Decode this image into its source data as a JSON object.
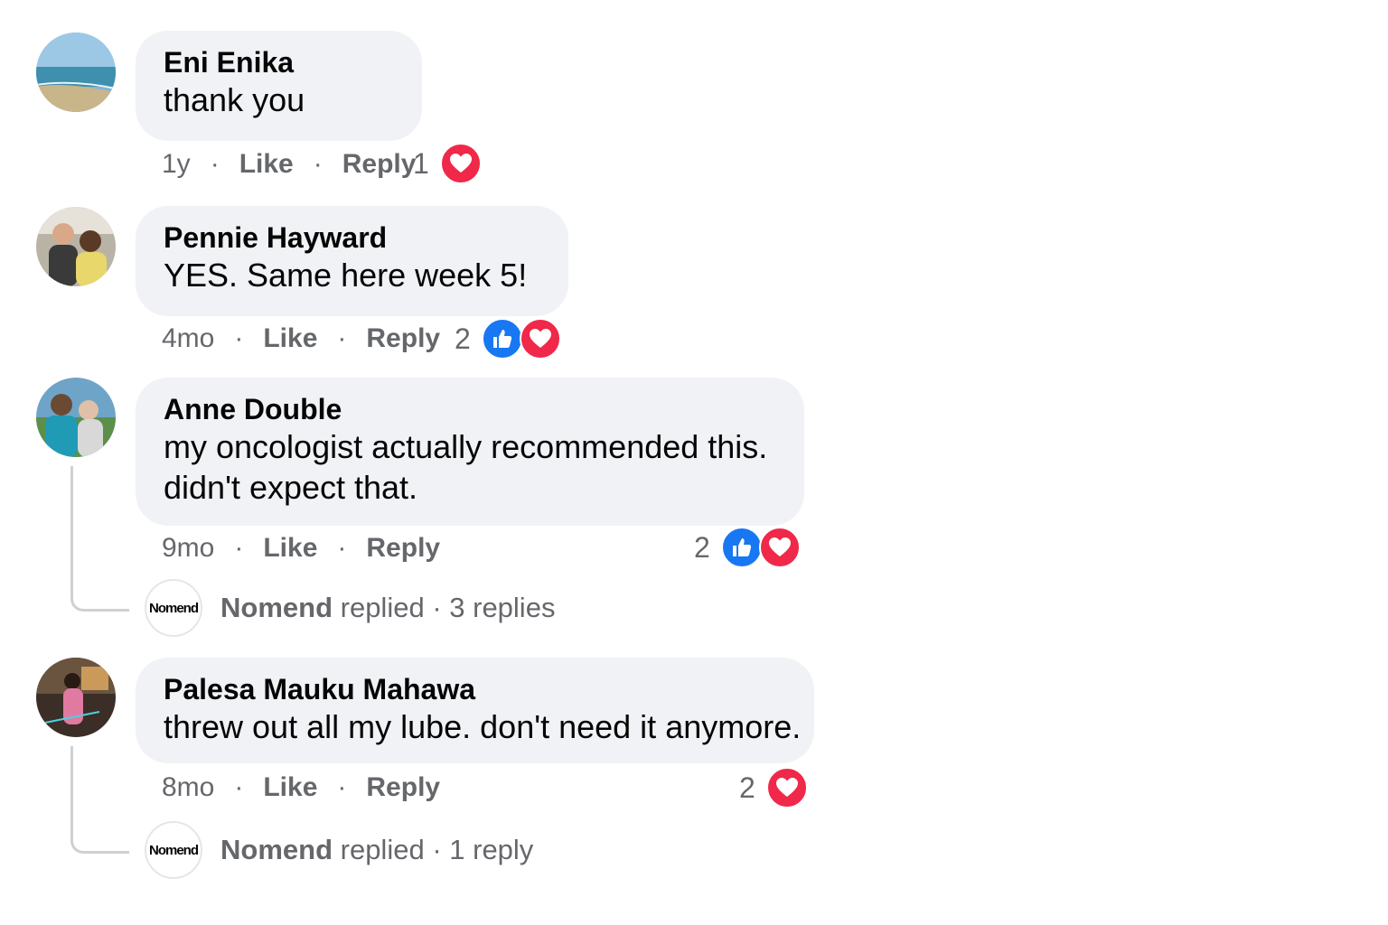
{
  "comments": [
    {
      "author": "Eni Enika",
      "text": [
        "thank you"
      ],
      "time": "1y",
      "like_label": "Like",
      "reply_label": "Reply",
      "reaction_count": "1",
      "reactions": [
        "heart"
      ]
    },
    {
      "author": "Pennie Hayward",
      "text": [
        "YES. Same here week 5!"
      ],
      "time": "4mo",
      "like_label": "Like",
      "reply_label": "Reply",
      "reaction_count": "2",
      "reactions": [
        "like",
        "heart"
      ]
    },
    {
      "author": "Anne Double",
      "text": [
        "my oncologist actually recommended this.",
        "didn't expect that."
      ],
      "time": "9mo",
      "like_label": "Like",
      "reply_label": "Reply",
      "reaction_count": "2",
      "reactions": [
        "like",
        "heart"
      ],
      "replies": {
        "avatar_label": "Nomend",
        "name": "Nomend",
        "verb": "replied",
        "count_text": "3 replies"
      }
    },
    {
      "author": "Palesa Mauku Mahawa",
      "text": [
        "threw out all my lube. don't need it anymore."
      ],
      "time": "8mo",
      "like_label": "Like",
      "reply_label": "Reply",
      "reaction_count": "2",
      "reactions": [
        "heart"
      ],
      "replies": {
        "avatar_label": "Nomend",
        "name": "Nomend",
        "verb": "replied",
        "count_text": "1 reply"
      }
    }
  ],
  "separator": "·",
  "colors": {
    "bubble": "#f0f2f5",
    "meta_text": "#65676b",
    "like_blue": "#1877f2",
    "heart_red": "#f02849"
  }
}
